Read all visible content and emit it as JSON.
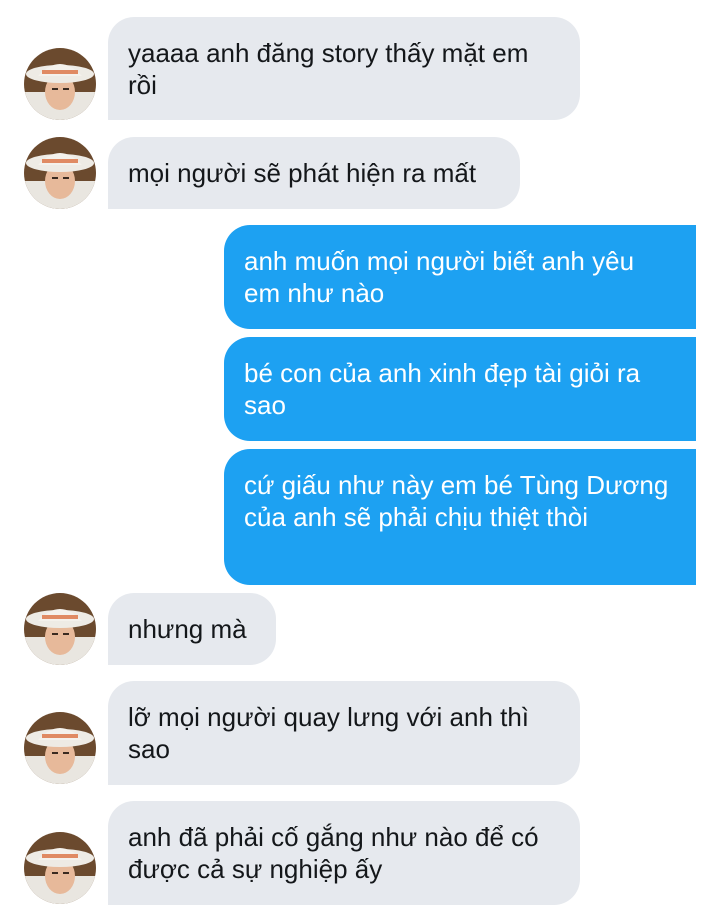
{
  "messages": [
    {
      "from": "them",
      "text": "yaaaa anh đăng story thấy mặt em rồi",
      "avatar": "profile-photo"
    },
    {
      "from": "them",
      "text": "mọi người sẽ phát hiện ra mất",
      "avatar": "profile-photo"
    },
    {
      "from": "me",
      "text": "anh muốn mọi người biết anh yêu em như nào"
    },
    {
      "from": "me",
      "text": "bé con của anh xinh đẹp tài giỏi ra sao"
    },
    {
      "from": "me",
      "text": "cứ giấu như này em bé Tùng Dương của anh sẽ phải chịu thiệt thòi"
    },
    {
      "from": "them",
      "text": "nhưng mà",
      "avatar": "profile-photo"
    },
    {
      "from": "them",
      "text": "lỡ mọi người quay lưng với anh thì sao",
      "avatar": "profile-photo"
    },
    {
      "from": "them",
      "text": "anh đã phải cố gắng như nào để có được cả sự nghiệp ấy",
      "avatar": "profile-photo"
    }
  ],
  "colors": {
    "incoming_bubble": "#e6e9ee",
    "outgoing_bubble": "#1da1f2",
    "incoming_text": "#14171a",
    "outgoing_text": "#ffffff"
  }
}
